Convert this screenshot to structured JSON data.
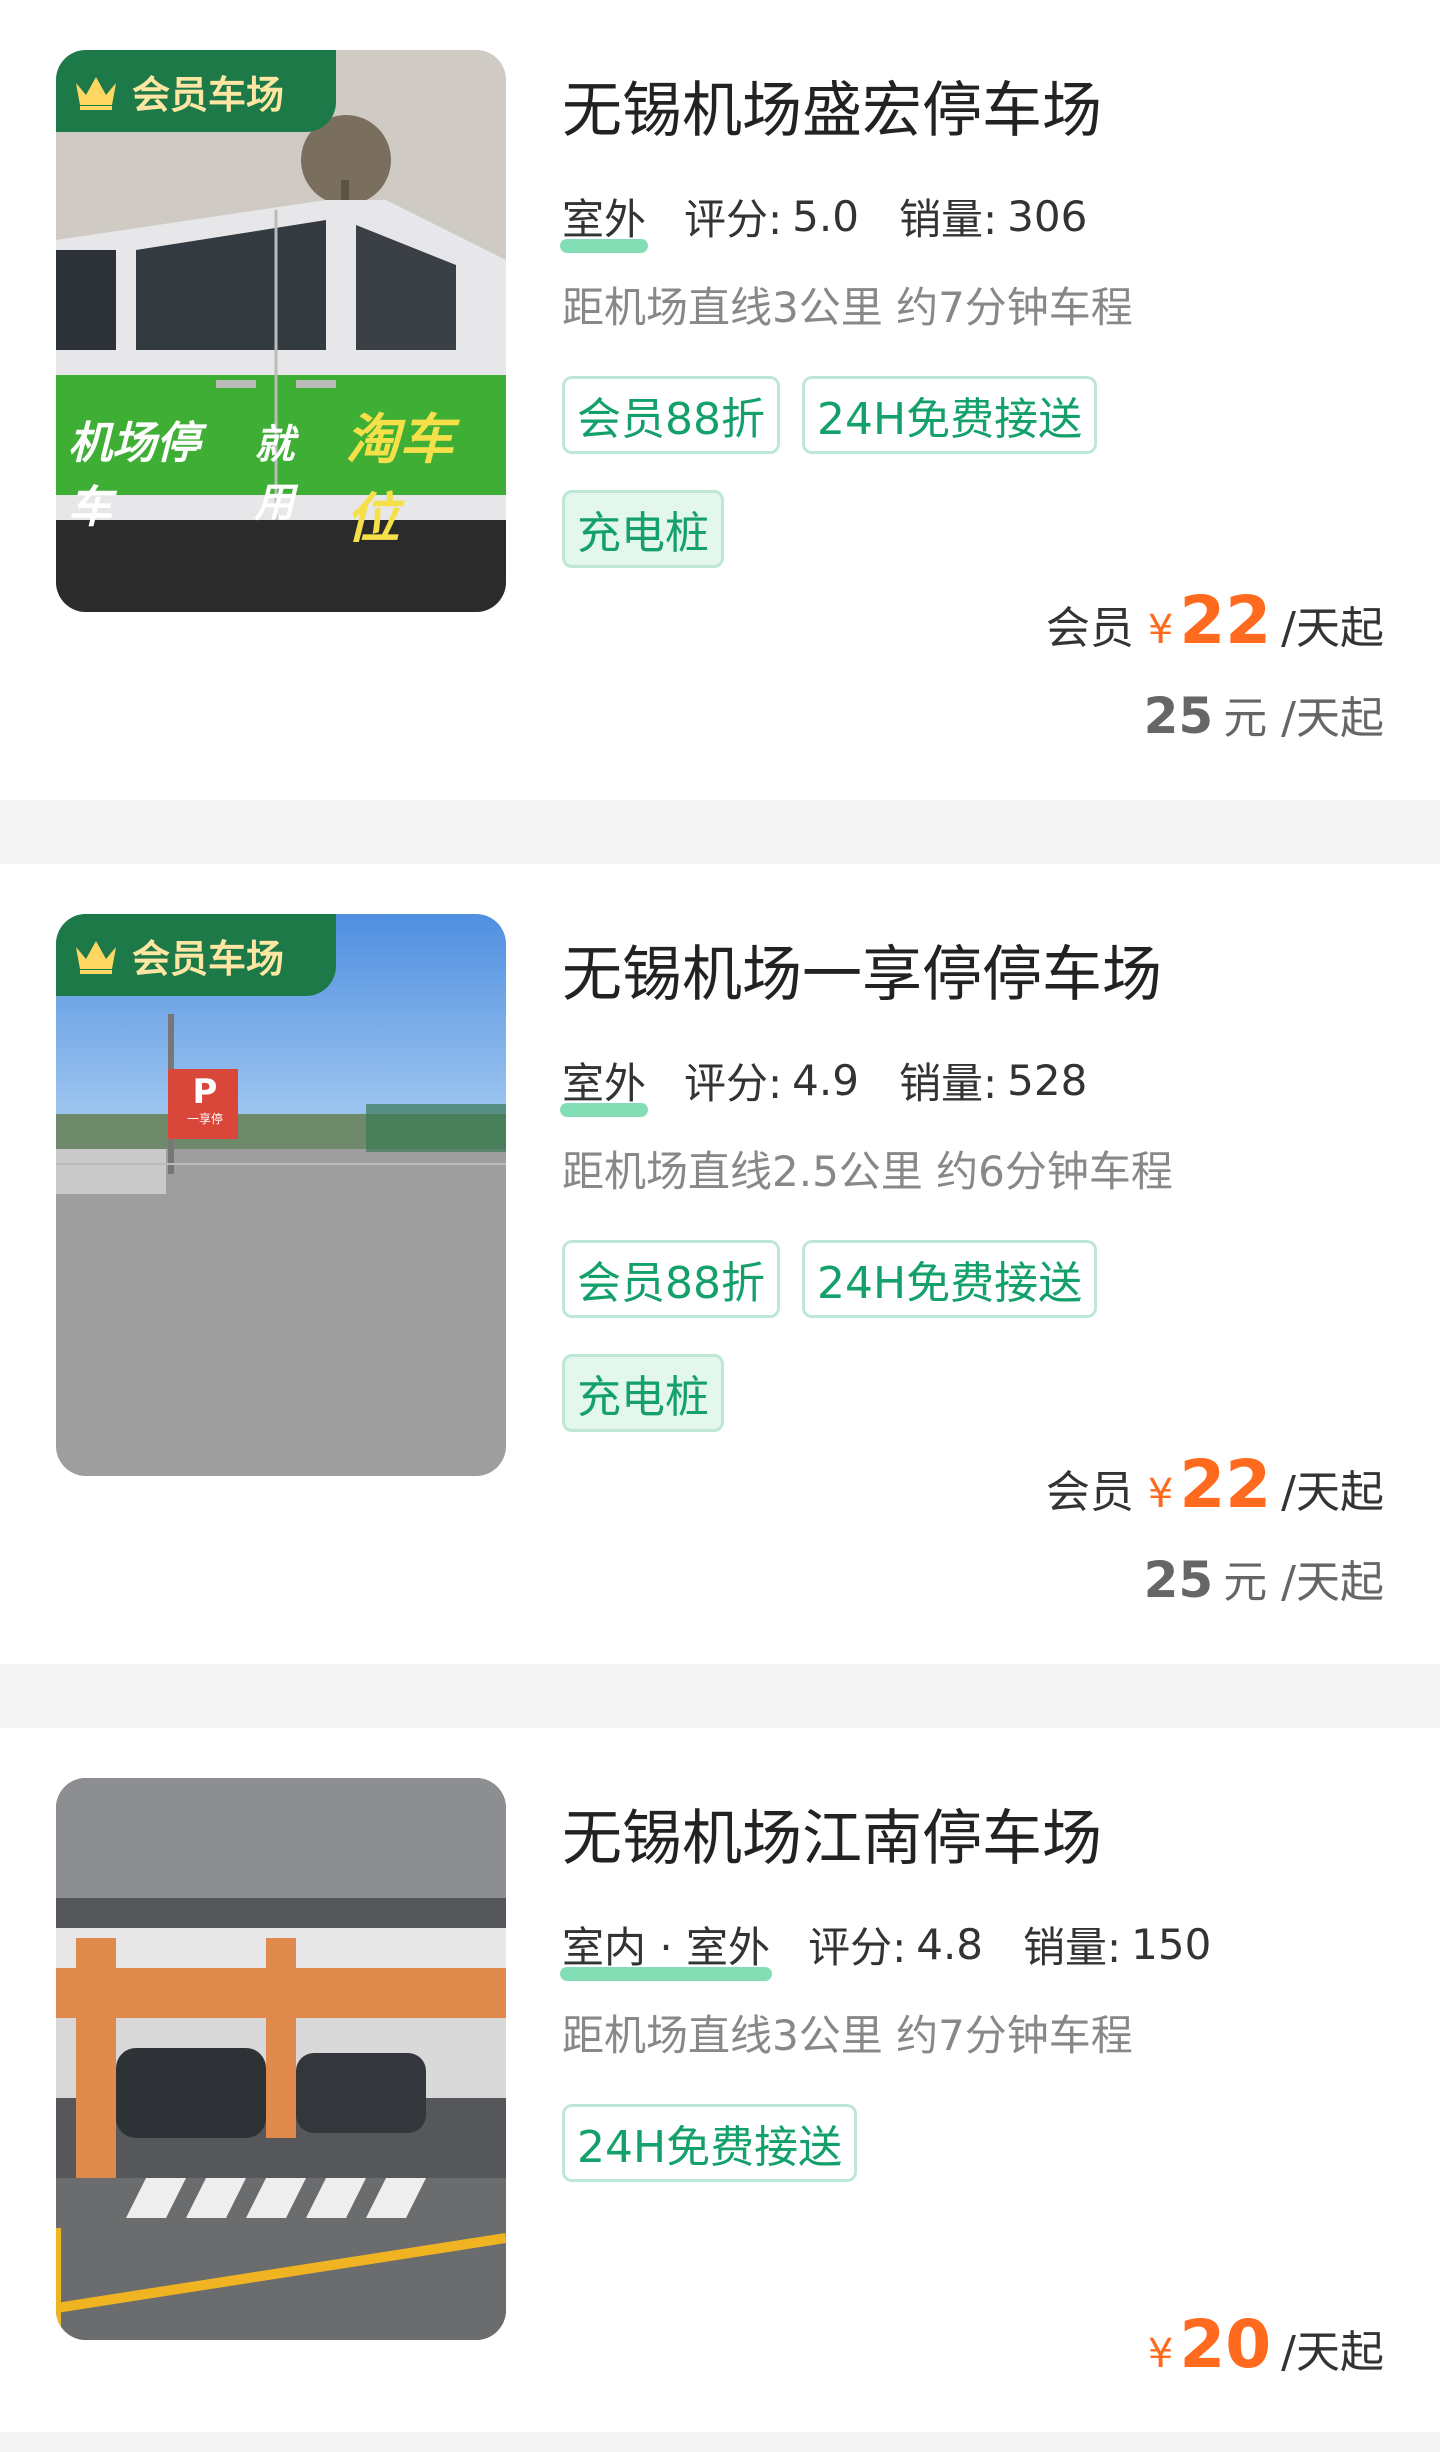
{
  "colors": {
    "accent": "#ff6a1e",
    "tag_green": "#13a06a",
    "badge_green": "#1d7a48"
  },
  "cards": [
    {
      "badge": "会员车场",
      "photo_text": [
        "机场停车",
        "就用",
        "淘车位"
      ],
      "title": "无锡机场盛宏停车场",
      "type": "室外",
      "rating_label": "评分:",
      "rating": "5.0",
      "sales_label": "销量:",
      "sales": "306",
      "distance": "距机场直线3公里 约7分钟车程",
      "tags": [
        "会员88折",
        "24H免费接送",
        "充电桩"
      ],
      "member_label": "会员",
      "currency": "¥",
      "price": "22",
      "unit": "/天起",
      "orig_price": "25",
      "orig_unit": "元 /天起"
    },
    {
      "badge": "会员车场",
      "photo_text": [
        "P",
        "一享停"
      ],
      "title": "无锡机场一享停停车场",
      "type": "室外",
      "rating_label": "评分:",
      "rating": "4.9",
      "sales_label": "销量:",
      "sales": "528",
      "distance": "距机场直线2.5公里 约6分钟车程",
      "tags": [
        "会员88折",
        "24H免费接送",
        "充电桩"
      ],
      "member_label": "会员",
      "currency": "¥",
      "price": "22",
      "unit": "/天起",
      "orig_price": "25",
      "orig_unit": "元 /天起"
    },
    {
      "title": "无锡机场江南停车场",
      "type": "室内 · 室外",
      "rating_label": "评分:",
      "rating": "4.8",
      "sales_label": "销量:",
      "sales": "150",
      "distance": "距机场直线3公里 约7分钟车程",
      "tags": [
        "24H免费接送"
      ],
      "currency": "¥",
      "price": "20",
      "unit": "/天起"
    }
  ]
}
